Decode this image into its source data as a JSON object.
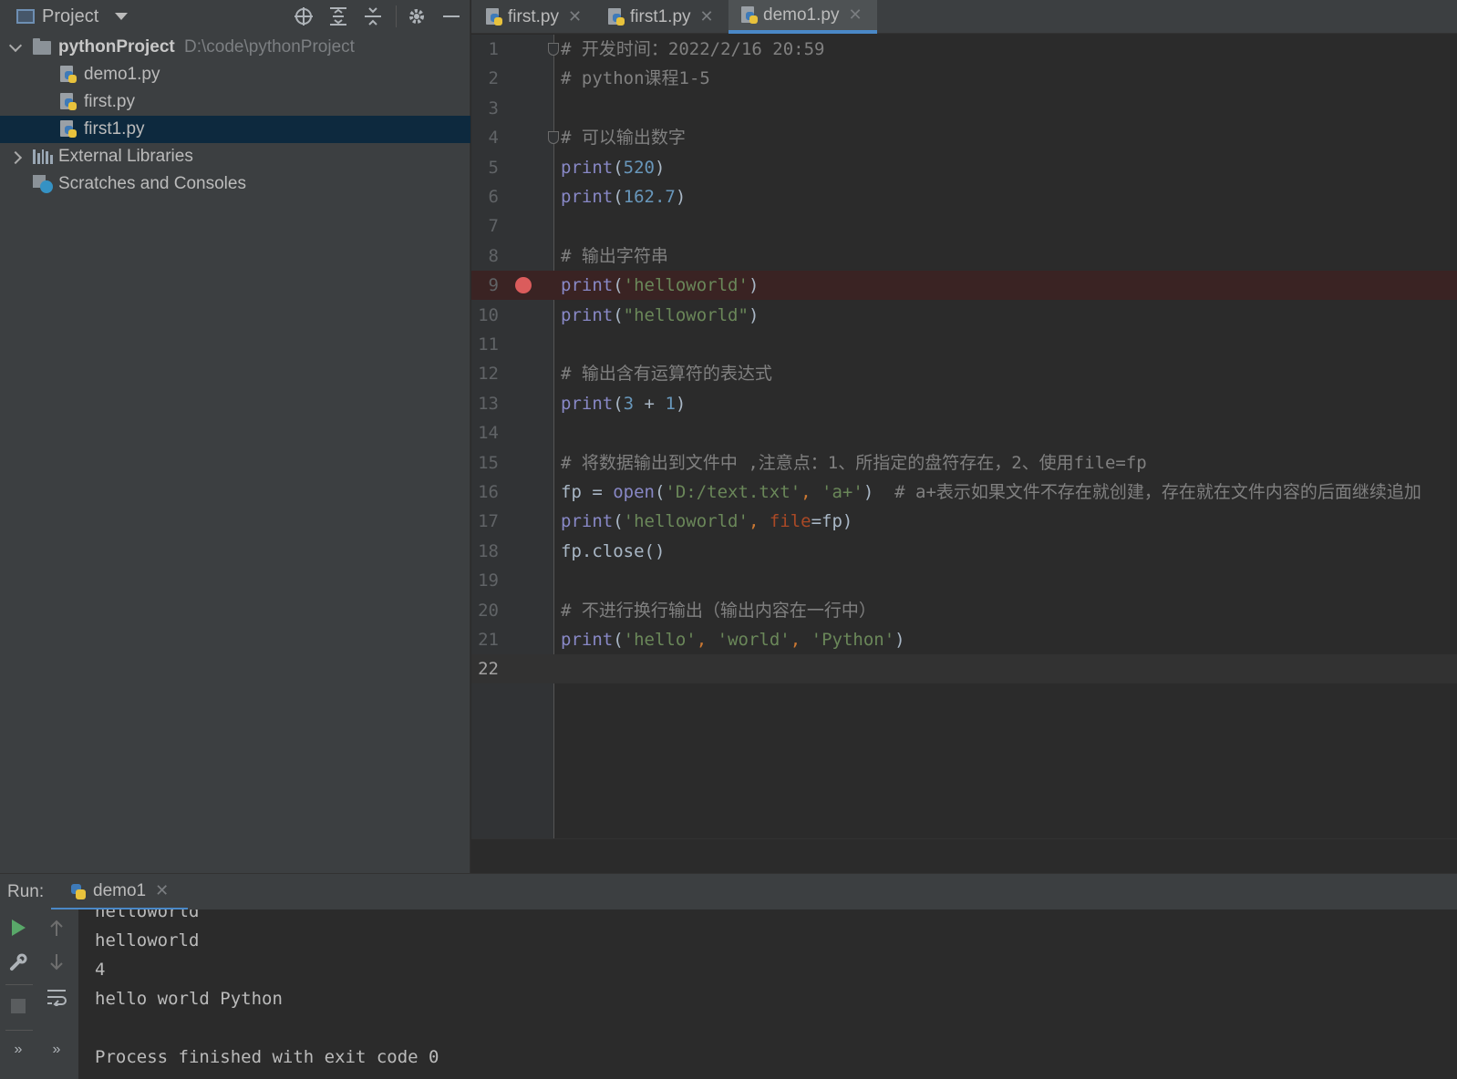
{
  "project_panel": {
    "title": "Project",
    "tree": {
      "project_name": "pythonProject",
      "project_path": "D:\\code\\pythonProject",
      "files": [
        "demo1.py",
        "first.py",
        "first1.py"
      ],
      "selected_file": "first1.py",
      "external_libraries": "External Libraries",
      "scratches": "Scratches and Consoles"
    }
  },
  "tabs": [
    {
      "label": "first.py",
      "active": false
    },
    {
      "label": "first1.py",
      "active": false
    },
    {
      "label": "demo1.py",
      "active": true
    }
  ],
  "editor": {
    "line_numbers": [
      "1",
      "2",
      "3",
      "4",
      "5",
      "6",
      "7",
      "8",
      "9",
      "10",
      "11",
      "12",
      "13",
      "14",
      "15",
      "16",
      "17",
      "18",
      "19",
      "20",
      "21",
      "22"
    ],
    "current_line": "22",
    "breakpoint_line": "9",
    "lines": [
      "# 开发时间：2022/2/16 20:59",
      "# python课程1-5",
      "",
      "# 可以输出数字",
      "print(520)",
      "print(162.7)",
      "",
      "# 输出字符串",
      "print('helloworld')",
      "print(\"helloworld\")",
      "",
      "# 输出含有运算符的表达式",
      "print(3 + 1)",
      "",
      "# 将数据输出到文件中 ,注意点：1、所指定的盘符存在，2、使用file=fp",
      "fp = open('D:/text.txt', 'a+')  # a+表示如果文件不存在就创建，存在就在文件内容的后面继续追加",
      "print('helloworld', file=fp)",
      "fp.close()",
      "",
      "# 不进行换行输出（输出内容在一行中）",
      "print('hello', 'world', 'Python')",
      ""
    ]
  },
  "run_panel": {
    "label": "Run:",
    "tab_label": "demo1",
    "output": [
      "helloworld",
      "helloworld",
      "4",
      "hello world Python",
      "",
      "Process finished with exit code 0"
    ]
  },
  "colors": {
    "background": "#2b2b2b",
    "panel": "#3c3f41",
    "selection": "#0d293e",
    "accent": "#4a88c7",
    "breakpoint": "#db5c5c",
    "string": "#6a8759",
    "number": "#6897bb",
    "builtin": "#8888c6",
    "comment": "#808080",
    "keyword_arg": "#aa4926"
  }
}
